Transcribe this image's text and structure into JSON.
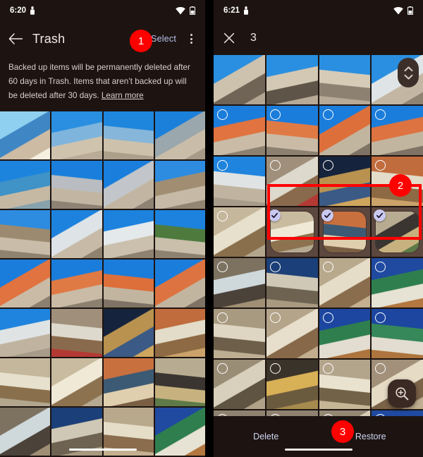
{
  "left_phone": {
    "status_bar": {
      "time": "6:20",
      "icons": [
        "portrait-lock-icon",
        "wifi-icon",
        "battery-icon"
      ]
    },
    "app_bar": {
      "back_icon": "arrow-back-icon",
      "title": "Trash",
      "select_label": "Select",
      "overflow_icon": "more-vert-icon"
    },
    "banner": {
      "text": "Backed up items will be permanently deleted after 60 days in Trash. Items that aren’t backed up will be deleted after 30 days. ",
      "link_label": "Learn more"
    }
  },
  "right_phone": {
    "status_bar": {
      "time": "6:21",
      "icons": [
        "portrait-lock-icon",
        "wifi-icon",
        "battery-icon"
      ]
    },
    "selection_bar": {
      "close_icon": "close-icon",
      "selected_count": "3"
    },
    "fab": {
      "icon": "zoom-in-icon"
    },
    "scroll_thumb": {
      "icon": "chevron-up-down-icon"
    },
    "action_bar": {
      "delete_label": "Delete",
      "restore_label": "Restore"
    }
  },
  "annotations": {
    "badges": [
      {
        "id": "1",
        "label": "1"
      },
      {
        "id": "2",
        "label": "2"
      },
      {
        "id": "3",
        "label": "3"
      }
    ],
    "color": "#ff0000"
  },
  "colors": {
    "surface": "#1d1411",
    "on_surface": "#f2e9e6",
    "accent_text": "#b9c3ee",
    "selected_tile": "#5c473f",
    "check_badge": "#c9c8f0",
    "annotation_red": "#ff0000"
  },
  "left_grid": {
    "columns": 4,
    "rows": [
      [
        "seafront-sunflare",
        "mucem-plaza-1",
        "mucem-plaza-2",
        "mucem-lattice-1"
      ],
      [
        "harbor-cathedral",
        "mucem-ramp-1",
        "mucem-ramp-2",
        "fort-plaza-1"
      ],
      [
        "fort-plaza-2",
        "villa-roof-1",
        "villa-roof-2",
        "plaza-trees"
      ],
      [
        "teddy-bear-1",
        "teddy-bear-2",
        "teddy-bear-3",
        "teddy-bear-4"
      ],
      [
        "cathedral-exterior",
        "pipe-organ",
        "church-altar-lit",
        "altar-painting"
      ],
      [
        "museum-panels-1",
        "museum-panels-2",
        "chapel-orange",
        "statue-figure"
      ],
      [
        "chapel-window",
        "blue-door-statue",
        "fresco-wall",
        "blue-mosaic-apse"
      ]
    ]
  },
  "right_grid": {
    "columns": 4,
    "rows": [
      {
        "tiles": [
          "plaza-crowd-1",
          "plaza-crowd-2",
          "plaza-crowd-3",
          "plaza-building"
        ],
        "selectable": false
      },
      {
        "tiles": [
          "teddy-bear-1",
          "teddy-bear-2",
          "teddy-bear-3",
          "teddy-bear-4"
        ],
        "selectable": true,
        "checked": []
      },
      {
        "tiles": [
          "cathedral-exterior",
          "pipe-organ",
          "church-altar-lit",
          "altar-painting"
        ],
        "selectable": true,
        "checked": []
      },
      {
        "tiles": [
          "museum-panels-1",
          "museum-panels-2",
          "chapel-orange",
          "statue-figure"
        ],
        "selectable": true,
        "checked": [
          1,
          2,
          3
        ]
      },
      {
        "tiles": [
          "chapel-window",
          "blue-door-statue",
          "fresco-wall",
          "blue-mosaic-apse"
        ],
        "selectable": true,
        "checked": []
      },
      {
        "tiles": [
          "nave-arches",
          "nave-fresco",
          "blue-vault-1",
          "blue-vault-2"
        ],
        "selectable": true,
        "checked": []
      },
      {
        "tiles": [
          "stone-stairs",
          "gold-statue",
          "dome-interior",
          "altar-side"
        ],
        "selectable": true,
        "checked": []
      },
      {
        "tiles": [
          "crypt-arch-1",
          "crypt-arch-2",
          "crypt-arch-3",
          "crypt-arch-4"
        ],
        "selectable": true,
        "checked": []
      }
    ]
  }
}
